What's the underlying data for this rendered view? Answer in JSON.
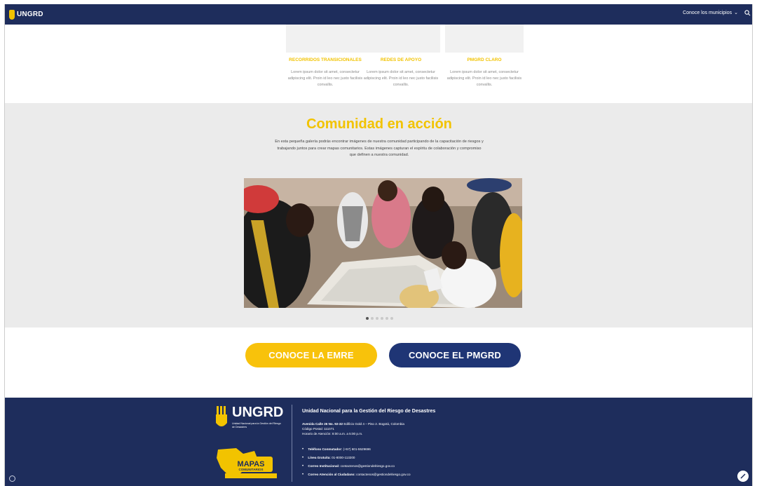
{
  "header": {
    "logo_text": "UNGRD",
    "nav_label": "Conoce los municipios"
  },
  "cards": [
    {
      "title": "Recorridos transicionales",
      "text": "Lorem ipsum dolor sit amet, consectetur adipiscing elit. Proin id leo nec justo facilisis convallis."
    },
    {
      "title": "Redes de apoyo",
      "text": "Lorem ipsum dolor sit amet, consectetur adipiscing elit. Proin id leo nec justo facilisis convallis."
    },
    {
      "title": "Pmgrd Claro",
      "text": "Lorem ipsum dolor sit amet, consectetur adipiscing elit. Proin id leo nec justo facilisis convallis."
    }
  ],
  "gallery": {
    "title": "Comunidad en acción",
    "description": "En esta pequeña galería podrás encontrar imágenes de nuestra comunidad participando de la capacitación de riesgos y trabajando juntos para crear mapas comunitarios. Estas imágenes capturan el espíritu de colaboración y compromiso que definen a nuestra comunidad.",
    "slide_count": 6,
    "active_slide": 0
  },
  "cta": {
    "emre_label": "CONOCE LA EMRE",
    "pmgrd_label": "CONOCE EL PMGRD"
  },
  "footer": {
    "logo_name": "UNGRD",
    "logo_sub": "Unidad Nacional para la Gestión del Riesgo de Desastres",
    "mapas_title": "MAPAS",
    "mapas_sub": "COMUNITARIOS",
    "heading": "Unidad Nacional para la Gestión del Riesgo de Desastres",
    "address_label": "Avenida Calle 26 No. 92-32",
    "address_rest": "Edificio Gold 4 – Piso 2. Bogotá, Colombia",
    "postal": "Código Postal: 111071",
    "hours": "Horario de Atención: 8:00 a.m. a 5:00 p.m.",
    "contacts": [
      {
        "label": "Teléfono Conmutador:",
        "value": "(+57) 601-5529696"
      },
      {
        "label": "Línea Gratuita:",
        "value": "01-8000-113200"
      },
      {
        "label": "Correo Institucional:",
        "value": "contactenos@gestiondelriesgo.gov.co"
      },
      {
        "label": "Correo Atención al Ciudadano:",
        "value": "contactenos@gestiondelriesgo.gov.co"
      }
    ]
  },
  "colors": {
    "navy": "#1e2d5c",
    "yellow": "#f2c300",
    "button_blue": "#1f3575"
  }
}
